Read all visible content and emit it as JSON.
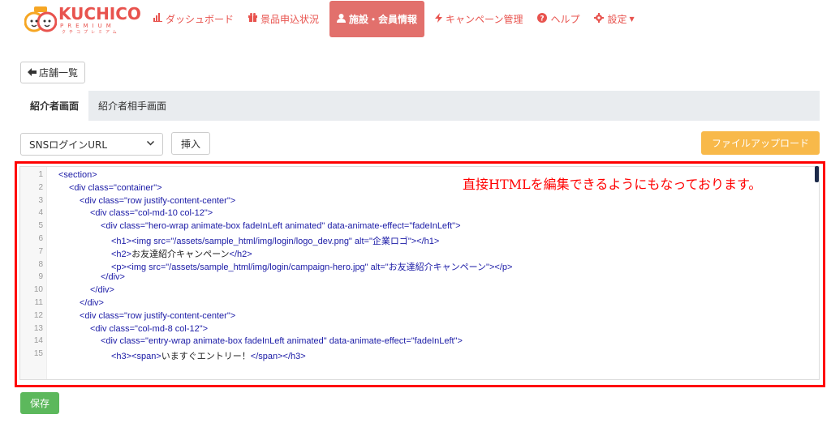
{
  "brand": {
    "name": "KUCHICO",
    "sub": "PREMIUM",
    "sub_kana": "クチコプレミアム",
    "color": "#e8534e"
  },
  "nav": {
    "items": [
      {
        "label": "ダッシュボード",
        "icon": "bar-chart-icon"
      },
      {
        "label": "景品申込状況",
        "icon": "gift-icon"
      },
      {
        "label": "施設・会員情報",
        "icon": "user-icon",
        "active": true
      },
      {
        "label": "キャンペーン管理",
        "icon": "bolt-icon"
      },
      {
        "label": "ヘルプ",
        "icon": "question-circle-icon"
      },
      {
        "label": "設定",
        "icon": "gear-icon",
        "dropdown": true
      }
    ]
  },
  "back_button": {
    "label": "店舗一覧"
  },
  "tabs": [
    {
      "label": "紹介者画面",
      "active": true
    },
    {
      "label": "紹介者相手画面",
      "active": false
    }
  ],
  "toolbar": {
    "select_value": "SNSログインURL",
    "insert_label": "挿入",
    "upload_label": "ファイルアップロード"
  },
  "annotation": "直接HTMLを編集できるようにもなっております。",
  "editor": {
    "lines": [
      {
        "n": "1",
        "indent": 0,
        "segs": [
          [
            "tag",
            "<section>"
          ]
        ]
      },
      {
        "n": "2",
        "indent": 1,
        "segs": [
          [
            "tag",
            "<div "
          ],
          [
            "attr",
            "class="
          ],
          [
            "val",
            "\"container\""
          ],
          [
            "tag",
            ">"
          ]
        ]
      },
      {
        "n": "3",
        "indent": 2,
        "segs": [
          [
            "tag",
            "<div "
          ],
          [
            "attr",
            "class="
          ],
          [
            "val",
            "\"row justify-content-center\""
          ],
          [
            "tag",
            ">"
          ]
        ]
      },
      {
        "n": "4",
        "indent": 3,
        "segs": [
          [
            "tag",
            "<div "
          ],
          [
            "attr",
            "class="
          ],
          [
            "val",
            "\"col-md-10 col-12\""
          ],
          [
            "tag",
            ">"
          ]
        ]
      },
      {
        "n": "5",
        "indent": 4,
        "segs": [
          [
            "tag",
            "<div "
          ],
          [
            "attr",
            "class="
          ],
          [
            "val",
            "\"hero-wrap animate-box fadeInLeft animated\""
          ],
          [
            "attr",
            " data-animate-effect="
          ],
          [
            "val",
            "\"fadeInLeft\""
          ],
          [
            "tag",
            ">"
          ]
        ]
      },
      {
        "n": "6",
        "indent": 5,
        "segs": [
          [
            "tag",
            "<h1><img "
          ],
          [
            "attr",
            "src="
          ],
          [
            "val",
            "\"/assets/sample_html/img/login/logo_dev.png\""
          ],
          [
            "attr",
            " alt="
          ],
          [
            "val",
            "\"企業ロゴ\""
          ],
          [
            "tag",
            "></h1>"
          ]
        ]
      },
      {
        "n": "7",
        "indent": 5,
        "segs": [
          [
            "tag",
            "<h2>"
          ],
          [
            "txt",
            "お友達紹介キャンペーン"
          ],
          [
            "tag",
            "</h2>"
          ]
        ]
      },
      {
        "n": "8",
        "indent": 5,
        "segs": [
          [
            "tag",
            "<p><img "
          ],
          [
            "attr",
            "src="
          ],
          [
            "val",
            "\"/assets/sample_html/img/login/campaign-hero.jpg\""
          ],
          [
            "attr",
            " alt="
          ],
          [
            "val",
            "\"お友達紹介キャンペーン\""
          ],
          [
            "tag",
            "></p>"
          ]
        ]
      },
      {
        "n": "9",
        "indent": 4,
        "segs": [
          [
            "tag",
            "</div>"
          ]
        ]
      },
      {
        "n": "10",
        "indent": 3,
        "segs": [
          [
            "tag",
            "</div>"
          ]
        ]
      },
      {
        "n": "11",
        "indent": 2,
        "segs": [
          [
            "tag",
            "</div>"
          ]
        ]
      },
      {
        "n": "12",
        "indent": 2,
        "segs": [
          [
            "tag",
            "<div "
          ],
          [
            "attr",
            "class="
          ],
          [
            "val",
            "\"row justify-content-center\""
          ],
          [
            "tag",
            ">"
          ]
        ]
      },
      {
        "n": "13",
        "indent": 3,
        "segs": [
          [
            "tag",
            "<div "
          ],
          [
            "attr",
            "class="
          ],
          [
            "val",
            "\"col-md-8 col-12\""
          ],
          [
            "tag",
            ">"
          ]
        ]
      },
      {
        "n": "14",
        "indent": 4,
        "segs": [
          [
            "tag",
            "<div "
          ],
          [
            "attr",
            "class="
          ],
          [
            "val",
            "\"entry-wrap animate-box fadeInLeft animated\""
          ],
          [
            "attr",
            " data-animate-effect="
          ],
          [
            "val",
            "\"fadeInLeft\""
          ],
          [
            "tag",
            ">"
          ]
        ]
      },
      {
        "n": "15",
        "indent": 5,
        "segs": [
          [
            "tag",
            "<h3><span>"
          ],
          [
            "txt",
            "いますぐエントリー！"
          ],
          [
            "tag",
            "</span></h3>"
          ]
        ]
      }
    ]
  },
  "save_label": "保存",
  "colors": {
    "active_nav": "#e2706c",
    "upload": "#f8b94a",
    "save": "#5cb85c",
    "highlight_frame": "#ff0000"
  }
}
